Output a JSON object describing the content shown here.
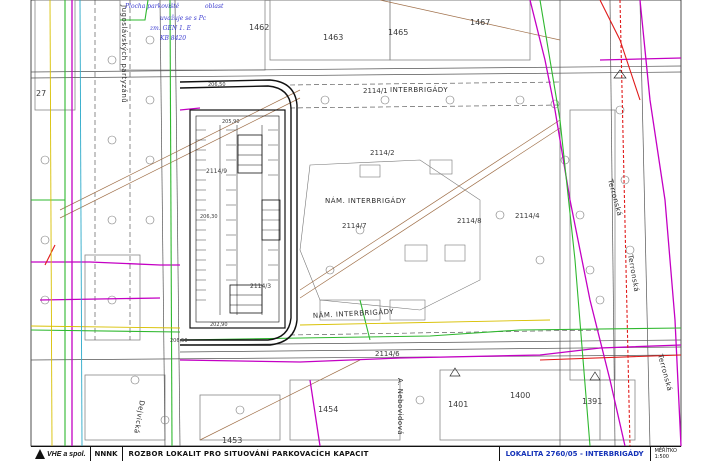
{
  "parcels": [
    "1462",
    "1463",
    "1465",
    "1467",
    "1454",
    "1453",
    "1401",
    "1400",
    "1391",
    "2114/2",
    "2114/7",
    "2114/8",
    "2114/4",
    "2114/3",
    "2114/9",
    "2114/6",
    "2114/1",
    "27"
  ],
  "levels": [
    "206,50",
    "205,90",
    "206,30",
    "202,90",
    "206,50"
  ],
  "streets": {
    "interbrigady_top": "INTERBRIGÁDY",
    "square_mid": "NÁM. INTERBRIGÁDY",
    "square_low": "NÁM. INTERBRIGÁDY",
    "jugoslavskych": "Jugoslávských partyzánů",
    "terronska_1": "Terronská",
    "terronska_2": "Terronská",
    "terronska_3": "Terronská",
    "nebovidova": "A. Nebovidová",
    "bottom_left": "Dejvická"
  },
  "handwritten": [
    "Plocha parkoviště",
    "uvažuje se s Pc",
    "zm. GEN 1. E",
    "KB 8420",
    "oblast"
  ],
  "title_block": {
    "company": "VHE a spol.",
    "company2": "NNNK",
    "project": "ROZBOR LOKALIT PRO SITUOVÁNÍ PARKOVACÍCH KAPACIT",
    "location": "LOKALITA 2760/05 - INTERBRIGÁDY",
    "scale_label": "MĚŘÍTKO",
    "scale_value": "1:500"
  },
  "colors": {
    "utility_magenta": "#c400c4",
    "utility_green": "#2fb82f",
    "utility_red": "#e01a1a",
    "utility_brown": "#a0704a",
    "garage_outline": "#111111",
    "label_blue": "#1533b8"
  }
}
